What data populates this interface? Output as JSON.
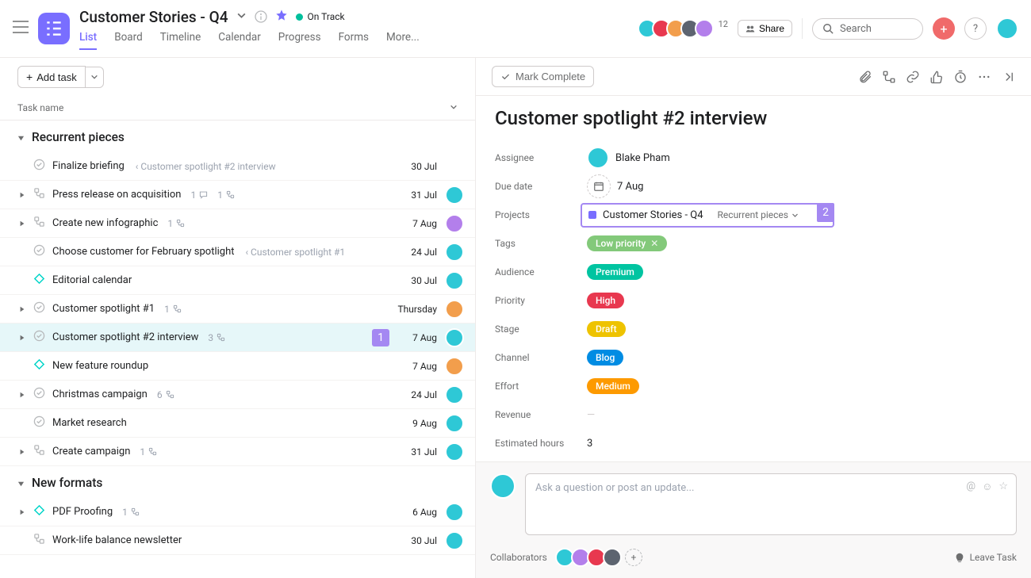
{
  "header": {
    "title": "Customer Stories - Q4",
    "status": "On Track",
    "tabs": [
      "List",
      "Board",
      "Timeline",
      "Calendar",
      "Progress",
      "Forms",
      "More..."
    ],
    "active_tab": "List",
    "member_count": "12",
    "share_label": "Share",
    "search_placeholder": "Search",
    "add_task_label": "Add task"
  },
  "column_header": "Task name",
  "sections": [
    {
      "title": "Recurrent pieces",
      "tasks": [
        {
          "icon": "task",
          "name": "Finalize briefing",
          "parent": "Customer spotlight #2 interview",
          "date": "30 Jul",
          "av": null,
          "expand": false
        },
        {
          "icon": "subtasks",
          "name": "Press release on acquisition",
          "meta_comment": "1",
          "meta_sub": "1",
          "date": "31 Jul",
          "av": "c1",
          "expand": true
        },
        {
          "icon": "subtasks",
          "name": "Create new infographic",
          "meta_sub": "1",
          "date": "7 Aug",
          "av": "c3",
          "expand": true
        },
        {
          "icon": "task",
          "name": "Choose customer for February spotlight",
          "parent": "Customer spotlight #1",
          "date": "24 Jul",
          "av": "c1",
          "expand": false
        },
        {
          "icon": "milestone",
          "name": "Editorial calendar",
          "date": "30 Jul",
          "av": "c1",
          "expand": false
        },
        {
          "icon": "task",
          "name": "Customer spotlight #1",
          "meta_sub": "1",
          "date": "Thursday",
          "av": "c2",
          "expand": true
        },
        {
          "icon": "task",
          "name": "Customer spotlight #2 interview",
          "meta_sub": "3",
          "date": "7 Aug",
          "av": "c1",
          "expand": true,
          "selected": true,
          "badge": "1"
        },
        {
          "icon": "milestone",
          "name": "New feature roundup",
          "date": "7 Aug",
          "av": "c2",
          "expand": false
        },
        {
          "icon": "task",
          "name": "Christmas campaign",
          "meta_sub": "6",
          "date": "24 Jul",
          "av": "c1",
          "expand": true
        },
        {
          "icon": "task",
          "name": "Market research",
          "date": "9 Aug",
          "av": "c1",
          "expand": false
        },
        {
          "icon": "subtasks",
          "name": "Create campaign",
          "meta_sub": "1",
          "date": "31 Jul",
          "av": "c1",
          "expand": true
        }
      ]
    },
    {
      "title": "New formats",
      "tasks": [
        {
          "icon": "milestone",
          "name": "PDF Proofing",
          "meta_sub": "1",
          "date": "6 Aug",
          "av": "c1",
          "expand": true
        },
        {
          "icon": "subtasks",
          "name": "Work-life balance newsletter",
          "date": "30 Jul",
          "av": "c1",
          "expand": false
        }
      ]
    }
  ],
  "detail": {
    "complete_label": "Mark Complete",
    "title": "Customer spotlight #2 interview",
    "fields": {
      "assignee_label": "Assignee",
      "assignee_value": "Blake Pham",
      "due_label": "Due date",
      "due_value": "7 Aug",
      "projects_label": "Projects",
      "project_name": "Customer Stories - Q4",
      "project_section": "Recurrent pieces",
      "project_badge": "2",
      "tags_label": "Tags",
      "tag_value": "Low priority",
      "audience_label": "Audience",
      "audience_value": "Premium",
      "priority_label": "Priority",
      "priority_value": "High",
      "stage_label": "Stage",
      "stage_value": "Draft",
      "channel_label": "Channel",
      "channel_value": "Blog",
      "effort_label": "Effort",
      "effort_value": "Medium",
      "revenue_label": "Revenue",
      "revenue_value": "—",
      "est_label": "Estimated hours",
      "est_value": "3"
    },
    "comment_placeholder": "Ask a question or post an update...",
    "collaborators_label": "Collaborators",
    "leave_label": "Leave Task"
  }
}
